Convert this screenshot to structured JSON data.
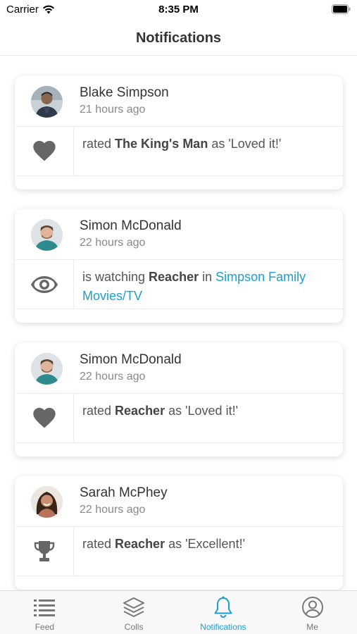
{
  "status_bar": {
    "carrier": "Carrier",
    "time": "8:35 PM"
  },
  "header": {
    "title": "Notifications"
  },
  "notifications": [
    {
      "user": "Blake Simpson",
      "time": "21 hours ago",
      "icon": "heart-icon",
      "verb": "rated ",
      "title": "The King's Man",
      "rest": " as 'Loved it!'"
    },
    {
      "user": "Simon McDonald",
      "time": "22 hours ago",
      "icon": "eye-icon",
      "verb": "is watching ",
      "title": "Reacher",
      "rest": " in ",
      "link": "Simpson Family Movies/TV"
    },
    {
      "user": "Simon McDonald",
      "time": "22 hours ago",
      "icon": "heart-icon",
      "verb": "rated ",
      "title": "Reacher",
      "rest": " as 'Loved it!'"
    },
    {
      "user": "Sarah McPhey",
      "time": "22 hours ago",
      "icon": "trophy-icon",
      "verb": "rated ",
      "title": "Reacher",
      "rest": " as 'Excellent!'"
    }
  ],
  "tabs": [
    {
      "label": "Feed",
      "icon": "list-icon"
    },
    {
      "label": "Colls",
      "icon": "layers-icon"
    },
    {
      "label": "Notifications",
      "icon": "bell-icon",
      "active": true
    },
    {
      "label": "Me",
      "icon": "user-circle-icon"
    }
  ],
  "colors": {
    "accent": "#1a9fcf",
    "icon_gray": "#666666",
    "text": "#333333"
  }
}
